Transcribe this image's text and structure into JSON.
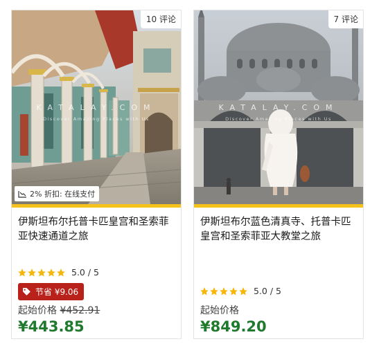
{
  "cards": [
    {
      "reviews": "10 评论",
      "watermark": "KATALAY.COM",
      "watermark_sub": "Discover Amazing Places with Us",
      "payment_badge": "2% 折扣: 在线支付",
      "title": "伊斯坦布尔托普卡匹皇宫和圣索菲亚快速通道之旅",
      "rating": "5.0 / 5",
      "stars": 5,
      "save_label": "节省 ¥9.06",
      "price_label": "起始价格",
      "old_price": "¥452.91",
      "price": "¥443.85"
    },
    {
      "reviews": "7 评论",
      "watermark": "KATALAY.COM",
      "watermark_sub": "Discover Amazing Places with Us",
      "title": "伊斯坦布尔蓝色清真寺、托普卡匹皇宫和圣索菲亚大教堂之旅",
      "rating": "5.0 / 5",
      "stars": 5,
      "price_label": "起始价格",
      "price": "¥849.20"
    }
  ],
  "colors": {
    "accent": "#f5c21b",
    "save_badge": "#b9211b",
    "price": "#1f7a2e",
    "star": "#f5b70b"
  },
  "icons": {
    "payment": "chart-down-icon",
    "save": "tag-icon",
    "star": "star-icon"
  }
}
